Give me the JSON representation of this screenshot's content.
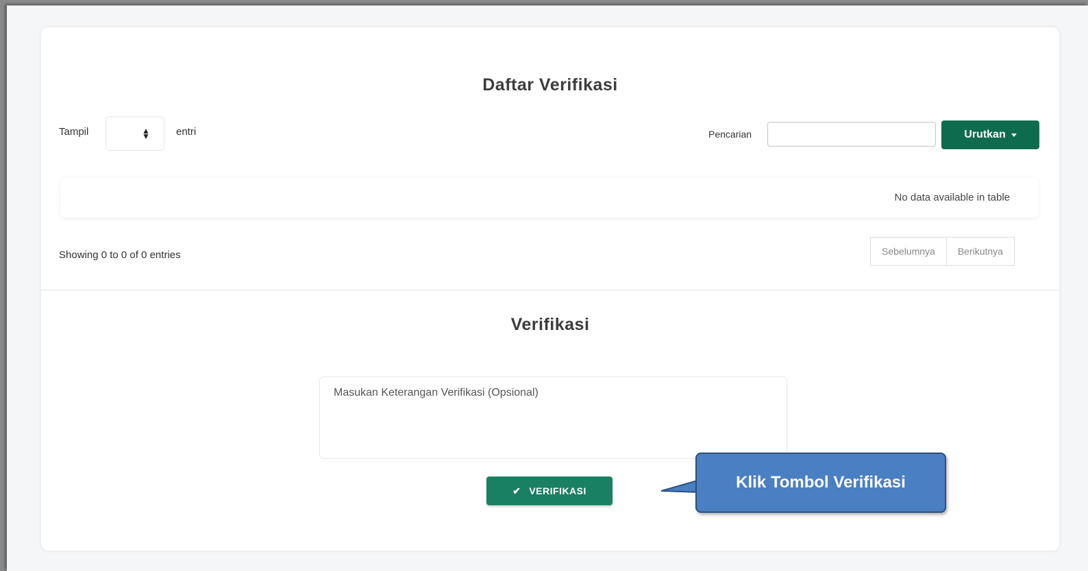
{
  "list": {
    "title": "Daftar Verifikasi",
    "length": {
      "label": "Tampil",
      "suffix": "entri",
      "value": ""
    },
    "search": {
      "label": "Pencarian",
      "value": ""
    },
    "sort_button": "Urutkan",
    "table": {
      "empty_message": "No data available in table"
    },
    "info": "Showing 0 to 0 of 0 entries",
    "pagination": {
      "prev": "Sebelumnya",
      "next": "Berikutnya"
    }
  },
  "verify": {
    "title": "Verifikasi",
    "note_placeholder": "Masukan Keterangan Verifikasi (Opsional)",
    "button": "VERIFIKASI"
  },
  "callout": {
    "text": "Klik Tombol Verifikasi"
  },
  "colors": {
    "primary_green": "#0e6b4e",
    "button_green": "#1a8062",
    "callout_blue": "#4a7fc1"
  },
  "icons": {
    "sort": "sort-icon",
    "caret": "caret-down-icon",
    "check": "check-icon"
  }
}
